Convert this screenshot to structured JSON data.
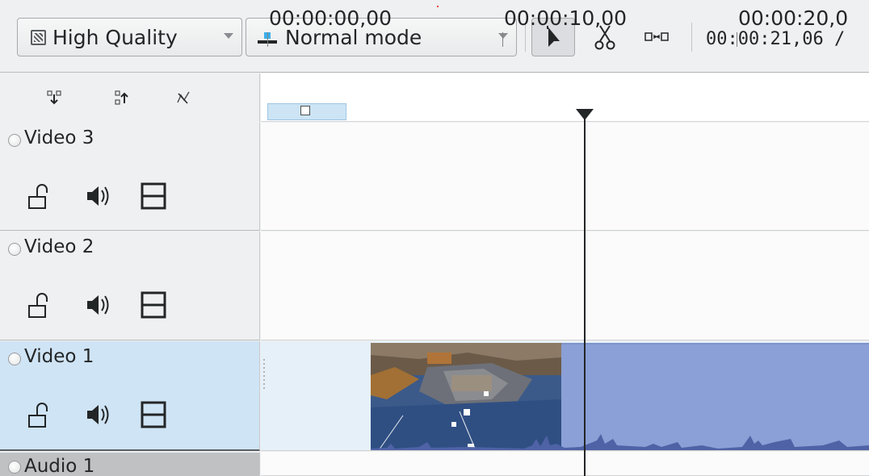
{
  "toolbar": {
    "quality_label": "High Quality",
    "mode_label": "Normal mode",
    "timecode": "00:00:21,06 /"
  },
  "ruler": {
    "labels": [
      "00:00:00,00",
      "00:00:10,00",
      "00:00:20,0"
    ]
  },
  "tracks": [
    {
      "name": "Video 3"
    },
    {
      "name": "Video 2"
    },
    {
      "name": "Video 1"
    },
    {
      "name": "Audio 1"
    }
  ],
  "colors": {
    "selection_blue": "#cfe4f5",
    "clip_blue": "#8aa0d6",
    "audio_track_bg": "#bfc1c3"
  }
}
